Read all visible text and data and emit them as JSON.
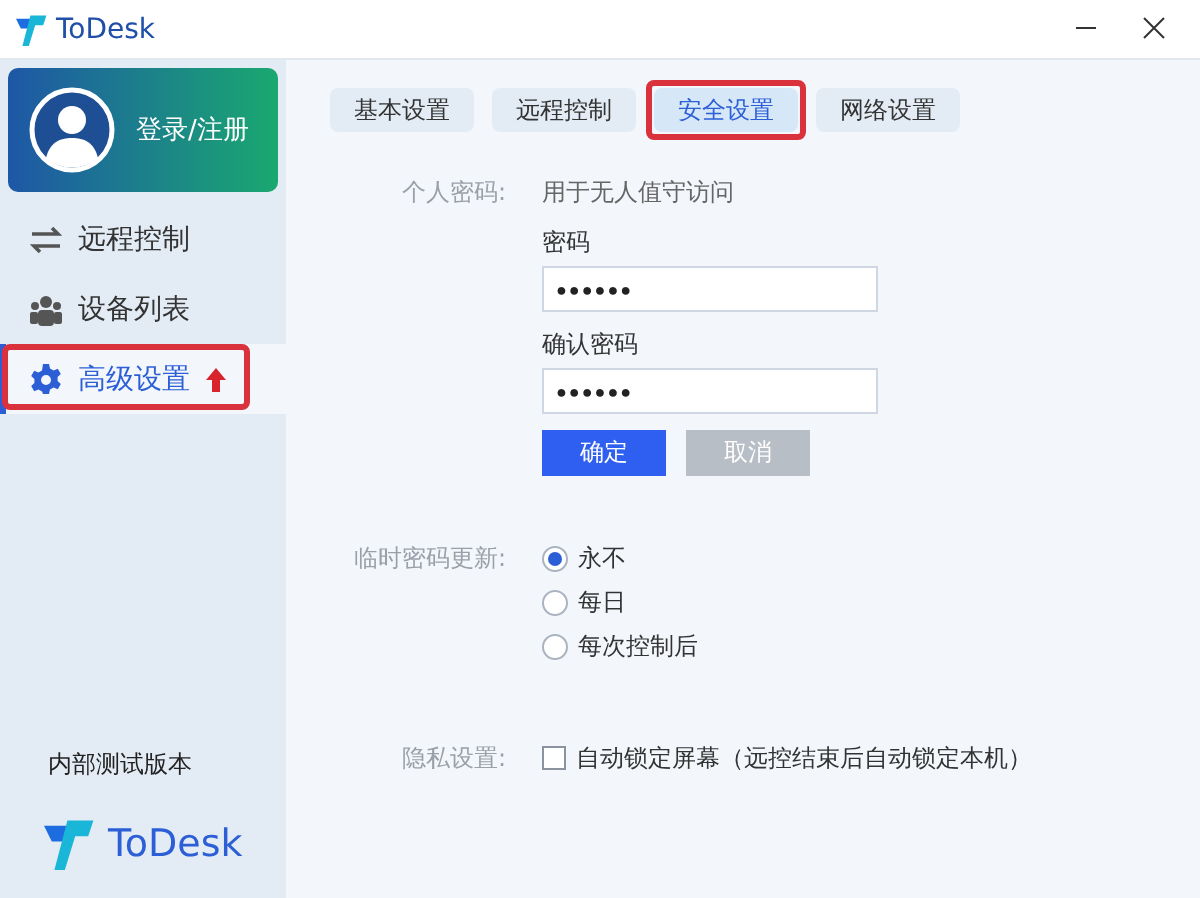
{
  "window": {
    "title": "ToDesk"
  },
  "sidebar": {
    "login": "登录/注册",
    "items": [
      {
        "label": "远程控制",
        "kind": "swap",
        "selected": false,
        "annotated": false
      },
      {
        "label": "设备列表",
        "kind": "users",
        "selected": false,
        "annotated": false
      },
      {
        "label": "高级设置",
        "kind": "gear",
        "selected": true,
        "annotated": true
      }
    ],
    "version": "内部测试版本",
    "brand": "ToDesk"
  },
  "tabs": [
    {
      "label": "基本设置",
      "selected": false,
      "annotated": false
    },
    {
      "label": "远程控制",
      "selected": false,
      "annotated": false
    },
    {
      "label": "安全设置",
      "selected": true,
      "annotated": true
    },
    {
      "label": "网络设置",
      "selected": false,
      "annotated": false
    }
  ],
  "personal_password": {
    "label": "个人密码:",
    "hint": "用于无人值守访问",
    "password_label": "密码",
    "password": "●●●●●●",
    "confirm_label": "确认密码",
    "confirm": "●●●●●●",
    "confirm_button": "确定",
    "cancel_button": "取消"
  },
  "temp_password": {
    "label": "临时密码更新:",
    "options": [
      {
        "label": "永不",
        "selected": true
      },
      {
        "label": "每日",
        "selected": false
      },
      {
        "label": "每次控制后",
        "selected": false
      }
    ]
  },
  "privacy": {
    "label": "隐私设置:",
    "option": {
      "label": "自动锁定屏幕（远控结束后自动锁定本机）",
      "checked": false
    }
  }
}
